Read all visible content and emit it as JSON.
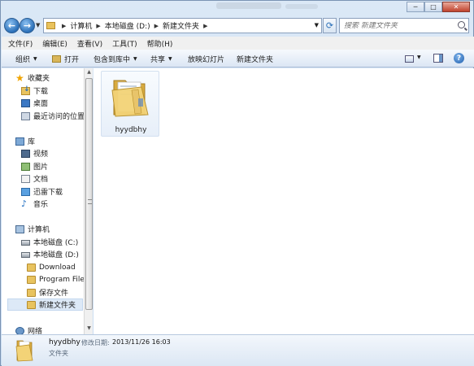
{
  "window": {
    "caption_buttons": {
      "minimize": "─",
      "maximize": "□",
      "close": "✕"
    }
  },
  "nav": {
    "back_glyph": "←",
    "forward_glyph": "→",
    "breadcrumb": [
      "计算机",
      "本地磁盘 (D:)",
      "新建文件夹"
    ],
    "search_placeholder": "搜索 新建文件夹"
  },
  "menubar": {
    "items": [
      "文件(F)",
      "编辑(E)",
      "查看(V)",
      "工具(T)",
      "帮助(H)"
    ]
  },
  "commandbar": {
    "organize": "组织",
    "open": "打开",
    "include_in_library": "包含到库中",
    "share": "共享",
    "slideshow": "放映幻灯片",
    "new_folder": "新建文件夹",
    "help": "?"
  },
  "navpane": {
    "favorites": "收藏夹",
    "downloads": "下载",
    "desktop": "桌面",
    "recent": "最近访问的位置",
    "libraries": "库",
    "videos": "视频",
    "pictures": "图片",
    "documents": "文档",
    "thunder": "迅雷下载",
    "music": "音乐",
    "computer": "计算机",
    "drive_c": "本地磁盘 (C:)",
    "drive_d": "本地磁盘 (D:)",
    "download_folder": "Download",
    "program_files": "Program Files",
    "saved_files": "保存文件",
    "new_folder": "新建文件夹",
    "network": "网络"
  },
  "content": {
    "items": [
      {
        "name": "hyydbhy"
      }
    ]
  },
  "details": {
    "name": "hyydbhy",
    "modified_label": "修改日期:",
    "modified_value": "2013/11/26 16:03",
    "type": "文件夹"
  }
}
